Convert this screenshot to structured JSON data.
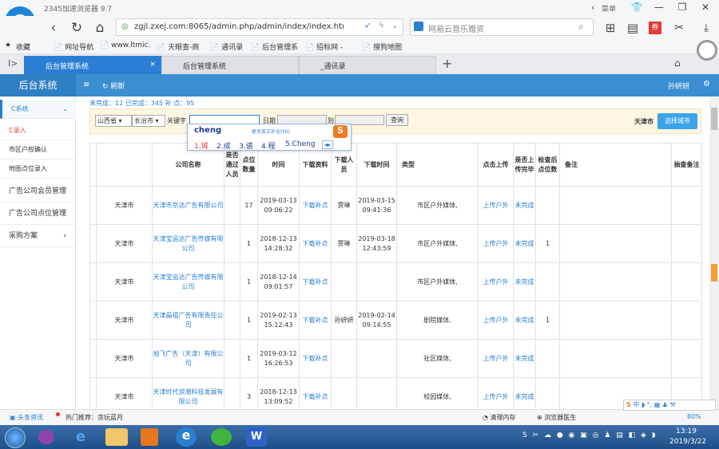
{
  "browser": {
    "title": "2345加速浏览器 9.7",
    "menu_label": "菜单",
    "url": "zgjl.zxej.com:8065/admin.php/admin/index/index.htı",
    "search_placeholder": "网易云音乐赠资"
  },
  "bookmarks": [
    "收藏",
    "网址导航",
    "www.ltmic.",
    "天眼查-商",
    "通讯录",
    "后台管理系",
    "招标网 -",
    "搜狗地图"
  ],
  "tabs": [
    {
      "label": "后台管理系统",
      "active": true
    },
    {
      "label": "后台管理系统",
      "active": false
    },
    {
      "label": "_通讯录",
      "active": false
    }
  ],
  "admin": {
    "title": "后台系统",
    "refresh": "刷新",
    "user": "孙妍妍"
  },
  "sidebar": {
    "items": [
      "C系统",
      "C录入",
      "市区户权确认",
      "地图点位录入",
      "广告公司会员管理",
      "广告公司点位管理",
      "采购方案"
    ]
  },
  "stats": "未完成：12 已完成：345 补 点：95",
  "filters": {
    "province": "山西省 ▾",
    "city": "长治市 ▾",
    "keyword_label": "关键字",
    "date_label": "日期",
    "to_label": "到",
    "query_button": "查询",
    "city_current": "天津市",
    "select_city_button": "选择城市"
  },
  "ime": {
    "input": "cheng",
    "hint": "更多英文补全(F6)",
    "candidates": [
      "1.城",
      "2.成",
      "3.谱",
      "4.程",
      "5.Cheng"
    ]
  },
  "table": {
    "headers": [
      "公司名称",
      "是否通过人员",
      "点位数量",
      "时间",
      "下载资料",
      "下载人员",
      "下载时间",
      "类型",
      "点击上传",
      "是否上传完毕",
      "检查后点位数",
      "备注",
      "抽查备注"
    ],
    "rows": [
      {
        "city": "天津市",
        "company": "天津市京达广告有限公司",
        "count": "17",
        "time": "2019-03-13 09:06:22",
        "dl": "下载补点",
        "person": "贾琳",
        "dltime": "2019-03-15 09:41:36",
        "type": "市区户外媒体,",
        "upload": "上传户外",
        "done": "未完成",
        "check": ""
      },
      {
        "city": "天津市",
        "company": "天津宝运达广告传媒有限公司",
        "count": "1",
        "time": "2018-12-13 14:28:32",
        "dl": "下载补点",
        "person": "贾琳",
        "dltime": "2019-03-18 12:43:59",
        "type": "市区户外媒体,",
        "upload": "上传户外",
        "done": "未完成",
        "check": "1"
      },
      {
        "city": "天津市",
        "company": "天津宝运达广告传媒有限公司",
        "count": "1",
        "time": "2018-12-14 09:01:57",
        "dl": "下载补点",
        "person": "",
        "dltime": "",
        "type": "市区户外媒体,",
        "upload": "上传户外",
        "done": "未完成",
        "check": ""
      },
      {
        "city": "天津市",
        "company": "天津晶禧广告有限责任公司",
        "count": "1",
        "time": "2019-02-13 15:12:43",
        "dl": "下载补点",
        "person": "孙妍妍",
        "dltime": "2019-02-14 09:14:55",
        "type": "剧院媒体,",
        "upload": "上传户外",
        "done": "未完成",
        "check": "1"
      },
      {
        "city": "天津市",
        "company": "旭飞广告（天津）有限公司",
        "count": "1",
        "time": "2019-03-12 16:26:53",
        "dl": "下载补点",
        "person": "",
        "dltime": "",
        "type": "社区媒体,",
        "upload": "上传户外",
        "done": "未完成",
        "check": ""
      },
      {
        "city": "天津市",
        "company": "天津时代浪潮科技发展有限公司",
        "count": "3",
        "time": "2018-12-13 13:09:52",
        "dl": "下载补点",
        "person": "",
        "dltime": "",
        "type": "校园媒体,",
        "upload": "上传户外",
        "done": "未完成",
        "check": ""
      }
    ]
  },
  "statusbar": {
    "news": "头条资讯",
    "hot": "热门推荐：贪玩蓝月",
    "clear": "清理内存",
    "doctor": "浏览器医生",
    "zoom": "80%"
  },
  "taskbar": {
    "time": "13:19",
    "date": "2019/3/22"
  }
}
